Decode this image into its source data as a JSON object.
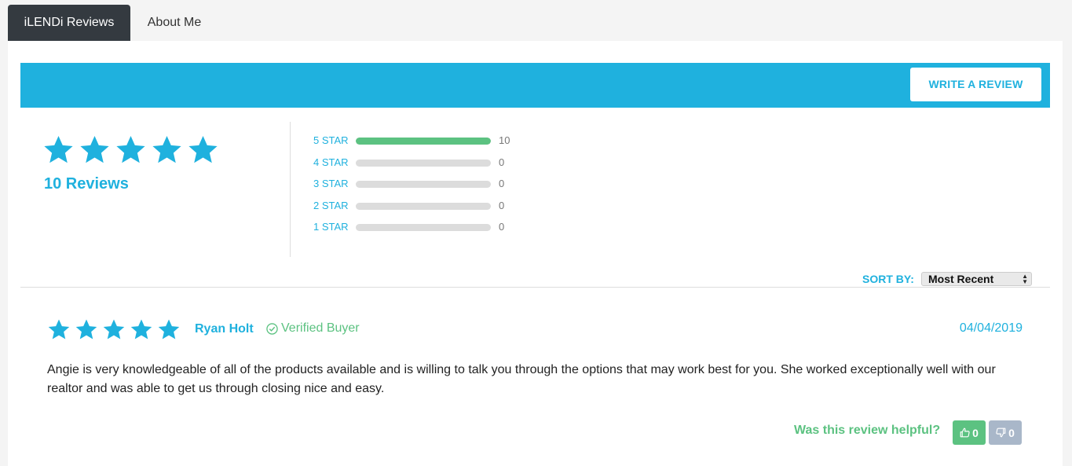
{
  "tabs": [
    {
      "label": "iLENDi Reviews",
      "active": true
    },
    {
      "label": "About Me",
      "active": false
    }
  ],
  "banner": {
    "color": "#1fb1de",
    "write_review_label": "WRITE A REVIEW"
  },
  "summary": {
    "rating": 5,
    "max_rating": 5,
    "review_count_label": "10 Reviews",
    "star_color": "#1fb1de"
  },
  "distribution": [
    {
      "label": "5 STAR",
      "count": "10",
      "fraction": 1.0
    },
    {
      "label": "4 STAR",
      "count": "0",
      "fraction": 0
    },
    {
      "label": "3 STAR",
      "count": "0",
      "fraction": 0
    },
    {
      "label": "2 STAR",
      "count": "0",
      "fraction": 0
    },
    {
      "label": "1 STAR",
      "count": "0",
      "fraction": 0
    }
  ],
  "sort": {
    "label": "SORT BY:",
    "selected": "Most Recent"
  },
  "reviews": [
    {
      "rating": 5,
      "author": "Ryan Holt",
      "badge": "Verified Buyer",
      "date": "04/04/2019",
      "body": "Angie is very knowledgeable of all of the products available and is willing to talk you through the options that may work best for you. She worked exceptionally well with our realtor and was able to get us through closing nice and easy.",
      "helpful_question": "Was this review helpful?",
      "upvotes": "0",
      "downvotes": "0"
    }
  ],
  "colors": {
    "accent": "#1fb1de",
    "positive": "#5cc281",
    "muted": "#a9b7c9"
  }
}
